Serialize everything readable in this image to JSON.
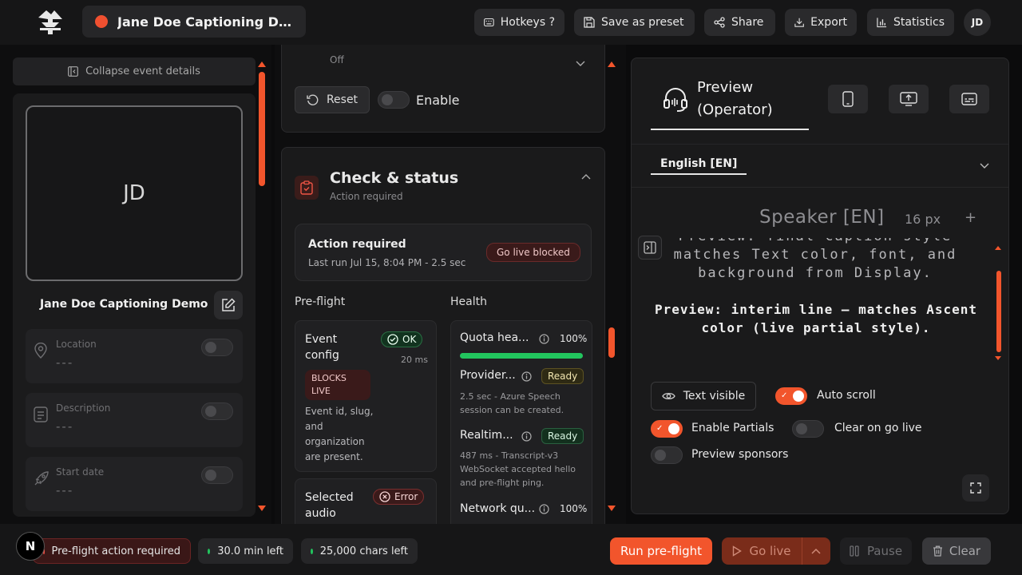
{
  "header": {
    "event_title": "Jane Doe Captioning Dem...",
    "buttons": {
      "hotkeys": "Hotkeys ?",
      "save_preset": "Save as preset",
      "share": "Share",
      "export": "Export",
      "statistics": "Statistics"
    },
    "user_initials": "JD"
  },
  "left_panel": {
    "collapse_label": "Collapse event details",
    "photo_initials": "JD",
    "event_name": "Jane Doe Captioning Demo",
    "fields": [
      {
        "label": "Location",
        "value": "---",
        "icon": "location-pin-icon",
        "enabled": false
      },
      {
        "label": "Description",
        "value": "---",
        "icon": "document-icon",
        "enabled": false
      },
      {
        "label": "Start date",
        "value": "---",
        "icon": "rocket-icon",
        "enabled": false
      }
    ]
  },
  "middle_panel": {
    "top_section": {
      "status_text": "Off",
      "reset_label": "Reset",
      "enable_label": "Enable",
      "enabled": false
    },
    "check_status": {
      "title": "Check & status",
      "subtitle": "Action required",
      "summary_title": "Action required",
      "summary_detail": "Last run Jul 15, 8:04 PM - 2.5 sec",
      "summary_badge": "Go live blocked",
      "preflight_heading": "Pre-flight",
      "health_heading": "Health",
      "preflight_items": [
        {
          "title": "Event config",
          "status": "OK",
          "time": "20 ms",
          "tag": "BLOCKS LIVE",
          "description": "Event id, slug, and organization are present."
        },
        {
          "title": "Selected audio",
          "status": "Error"
        }
      ],
      "health_items": [
        {
          "title": "Quota hea...",
          "value": "100%",
          "progress": 1.0
        },
        {
          "title": "Provider...",
          "badge": "Ready",
          "description": "2.5 sec - Azure Speech session can be created."
        },
        {
          "title": "Realtim...",
          "badge": "Ready",
          "description": "487 ms - Transcript-v3 WebSocket accepted hello and pre-flight ping."
        },
        {
          "title": "Network qu...",
          "value": "100%"
        }
      ]
    }
  },
  "right_panel": {
    "tab_label": "Preview (Operator)",
    "language": "English [EN]",
    "speaker_label": "Speaker [EN]",
    "font_size": "16 px",
    "plus_label": "+",
    "preview_final": "Preview: final caption style matches Text color, font, and background from Display.",
    "preview_final_lines": [
      "Preview: final caption style",
      "matches Text color, font, and",
      "background from Display."
    ],
    "preview_interim_lines": [
      "Preview: interim line — matches Ascent",
      "color (live partial style)."
    ],
    "controls": {
      "text_visible": "Text visible",
      "auto_scroll": "Auto scroll",
      "auto_scroll_on": true,
      "enable_partials": "Enable Partials",
      "enable_partials_on": true,
      "clear_on_go_live": "Clear on go live",
      "clear_on_go_live_on": false,
      "preview_sponsors": "Preview sponsors",
      "preview_sponsors_on": false
    }
  },
  "footer": {
    "n_badge": "N",
    "preflight_status": "Pre-flight action required",
    "time_left": "30.0 min left",
    "chars_left": "25,000 chars left",
    "run_preflight": "Run pre-flight",
    "go_live": "Go live",
    "pause": "Pause",
    "clear": "Clear"
  },
  "colors": {
    "accent": "#f2552c",
    "ok_green": "#22c55e",
    "error_red": "#e04848"
  }
}
